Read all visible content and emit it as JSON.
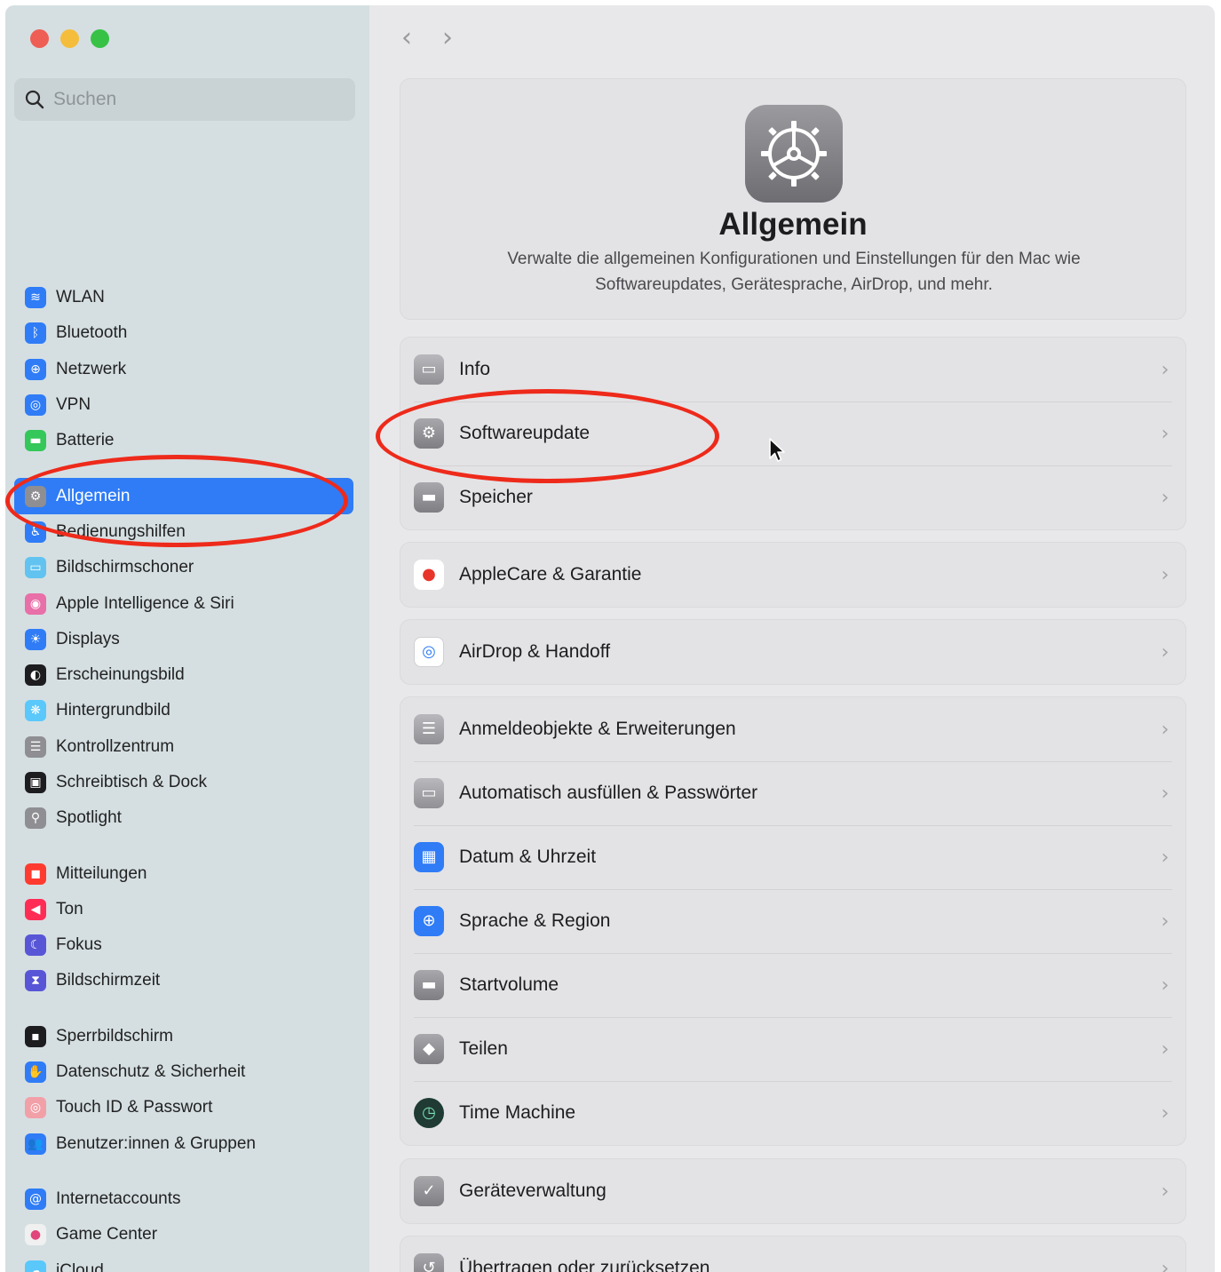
{
  "search": {
    "placeholder": "Suchen"
  },
  "nav": {
    "back": "‹",
    "forward": "›"
  },
  "sidebar": {
    "groups": [
      {
        "items": [
          {
            "label": "WLAN",
            "icon": "wifi-icon",
            "color": "#2f7cf6",
            "glyph": "≋"
          },
          {
            "label": "Bluetooth",
            "icon": "bluetooth-icon",
            "color": "#2f7cf6",
            "glyph": "ᛒ"
          },
          {
            "label": "Netzwerk",
            "icon": "globe-icon",
            "color": "#2f7cf6",
            "glyph": "⊕"
          },
          {
            "label": "VPN",
            "icon": "vpn-icon",
            "color": "#2f7cf6",
            "glyph": "◎"
          },
          {
            "label": "Batterie",
            "icon": "battery-icon",
            "color": "#34c759",
            "glyph": "▬"
          }
        ]
      },
      {
        "items": [
          {
            "label": "Allgemein",
            "icon": "gear-icon",
            "color": "#8e8e93",
            "glyph": "⚙",
            "active": true
          },
          {
            "label": "Bedienungshilfen",
            "icon": "accessibility-icon",
            "color": "#2f7cf6",
            "glyph": "♿"
          },
          {
            "label": "Bildschirmschoner",
            "icon": "screensaver-icon",
            "color": "#62c3f0",
            "glyph": "▭"
          },
          {
            "label": "Apple Intelligence & Siri",
            "icon": "siri-icon",
            "color": "#e86fa8",
            "glyph": "◉"
          },
          {
            "label": "Displays",
            "icon": "sun-icon",
            "color": "#2f7cf6",
            "glyph": "☀"
          },
          {
            "label": "Erscheinungsbild",
            "icon": "appearance-icon",
            "color": "#1d1d1f",
            "glyph": "◐"
          },
          {
            "label": "Hintergrundbild",
            "icon": "wallpaper-icon",
            "color": "#5ac8fa",
            "glyph": "❋"
          },
          {
            "label": "Kontrollzentrum",
            "icon": "control-center-icon",
            "color": "#8e8e93",
            "glyph": "☰"
          },
          {
            "label": "Schreibtisch & Dock",
            "icon": "dock-icon",
            "color": "#1d1d1f",
            "glyph": "▣"
          },
          {
            "label": "Spotlight",
            "icon": "spotlight-icon",
            "color": "#8e8e93",
            "glyph": "⚲"
          }
        ]
      },
      {
        "items": [
          {
            "label": "Mitteilungen",
            "icon": "notifications-icon",
            "color": "#ff3b30",
            "glyph": "◼"
          },
          {
            "label": "Ton",
            "icon": "speaker-icon",
            "color": "#ff2d55",
            "glyph": "◀"
          },
          {
            "label": "Fokus",
            "icon": "moon-icon",
            "color": "#5856d6",
            "glyph": "☾"
          },
          {
            "label": "Bildschirmzeit",
            "icon": "hourglass-icon",
            "color": "#5856d6",
            "glyph": "⧗"
          }
        ]
      },
      {
        "items": [
          {
            "label": "Sperrbildschirm",
            "icon": "lock-icon",
            "color": "#1d1d1f",
            "glyph": "▪"
          },
          {
            "label": "Datenschutz & Sicherheit",
            "icon": "hand-icon",
            "color": "#2f7cf6",
            "glyph": "✋"
          },
          {
            "label": "Touch ID & Passwort",
            "icon": "fingerprint-icon",
            "color": "#f2a0a8",
            "glyph": "◎"
          },
          {
            "label": "Benutzer:innen & Gruppen",
            "icon": "users-icon",
            "color": "#2f7cf6",
            "glyph": "👥"
          }
        ]
      },
      {
        "items": [
          {
            "label": "Internetaccounts",
            "icon": "at-icon",
            "color": "#2f7cf6",
            "glyph": "@"
          },
          {
            "label": "Game Center",
            "icon": "game-center-icon",
            "color": "#f0f0f0",
            "glyph": "●"
          },
          {
            "label": "iCloud",
            "icon": "cloud-icon",
            "color": "#5ac8fa",
            "glyph": "☁"
          }
        ]
      }
    ]
  },
  "hero": {
    "title": "Allgemein",
    "description": "Verwalte die allgemeinen Konfigurationen und Einstellungen für den Mac wie Softwareupdates, Gerätesprache, AirDrop, und mehr."
  },
  "cards": [
    {
      "rows": [
        {
          "label": "Info",
          "icon": "laptop-icon",
          "style": "gray-light",
          "glyph": "▭"
        },
        {
          "label": "Softwareupdate",
          "icon": "software-update-icon",
          "style": "gray",
          "glyph": "⚙"
        },
        {
          "label": "Speicher",
          "icon": "storage-icon",
          "style": "gray",
          "glyph": "▬"
        }
      ]
    },
    {
      "rows": [
        {
          "label": "AppleCare & Garantie",
          "icon": "apple-icon",
          "style": "white-red",
          "glyph": "●"
        }
      ]
    },
    {
      "rows": [
        {
          "label": "AirDrop & Handoff",
          "icon": "airdrop-icon",
          "style": "white-blue",
          "glyph": "◎"
        }
      ]
    },
    {
      "rows": [
        {
          "label": "Anmeldeobjekte & Erweiterungen",
          "icon": "list-icon",
          "style": "gray-light",
          "glyph": "☰"
        },
        {
          "label": "Automatisch ausfüllen & Passwörter",
          "icon": "autofill-icon",
          "style": "gray-light",
          "glyph": "▭"
        },
        {
          "label": "Datum & Uhrzeit",
          "icon": "calendar-clock-icon",
          "style": "blue",
          "glyph": "▦"
        },
        {
          "label": "Sprache & Region",
          "icon": "globe-icon",
          "style": "blue",
          "glyph": "⊕"
        },
        {
          "label": "Startvolume",
          "icon": "disk-icon",
          "style": "gray",
          "glyph": "▬"
        },
        {
          "label": "Teilen",
          "icon": "share-icon",
          "style": "gray",
          "glyph": "◆"
        },
        {
          "label": "Time Machine",
          "icon": "time-machine-icon",
          "style": "dark-green",
          "glyph": "◷"
        }
      ]
    },
    {
      "rows": [
        {
          "label": "Geräteverwaltung",
          "icon": "checkmark-badge-icon",
          "style": "gray",
          "glyph": "✓"
        }
      ]
    },
    {
      "rows": [
        {
          "label": "Übertragen oder zurücksetzen",
          "icon": "reset-icon",
          "style": "gray",
          "glyph": "↺"
        }
      ]
    }
  ],
  "colors": {
    "accent": "#2f7cf6",
    "annotation": "#ee2a1b"
  }
}
